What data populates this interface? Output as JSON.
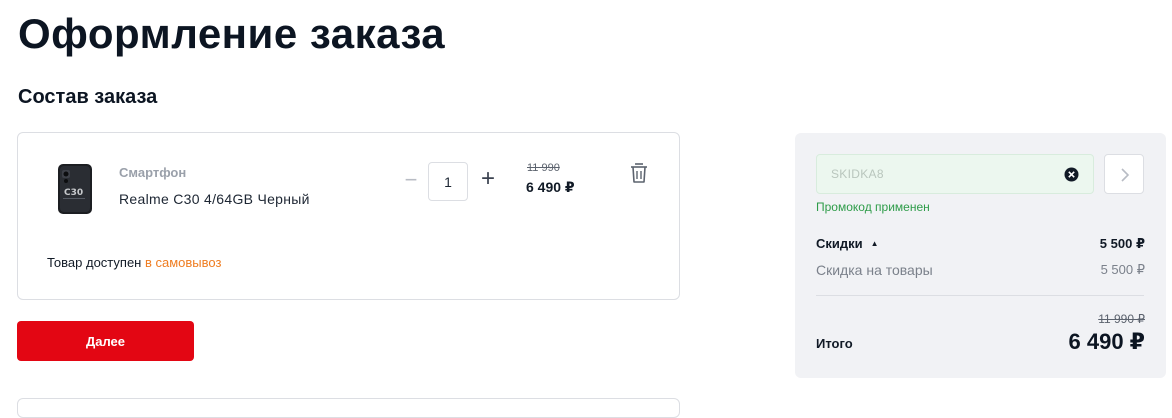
{
  "page": {
    "title": "Оформление заказа",
    "section_title": "Состав заказа"
  },
  "cart": {
    "item": {
      "category": "Смартфон",
      "name": "Realme C30 4/64GB Черный",
      "image_icon": "smartphone-image",
      "quantity": "1",
      "minus_label": "−",
      "plus_label": "+",
      "price_old": "11 990",
      "price_new": "6 490 ₽"
    },
    "availability_prefix": "Товар доступен ",
    "availability_link": "в самовывоз"
  },
  "actions": {
    "next_label": "Далее"
  },
  "summary": {
    "promo": {
      "value": "SKIDKA8",
      "status": "Промокод применен",
      "clear_icon": "close-circle-icon",
      "submit_icon": "chevron-right-icon"
    },
    "discounts_label": "Скидки",
    "discounts_value": "5 500 ₽",
    "goods_discount_label": "Скидка на товары",
    "goods_discount_value": "5 500 ₽",
    "total_old": "11 990 ₽",
    "total_label": "Итого",
    "total_value": "6 490 ₽"
  },
  "colors": {
    "accent_red": "#e30613",
    "pickup_orange": "#ef7d21",
    "promo_green": "#2e9c49",
    "summary_bg": "#f1f2f5"
  }
}
